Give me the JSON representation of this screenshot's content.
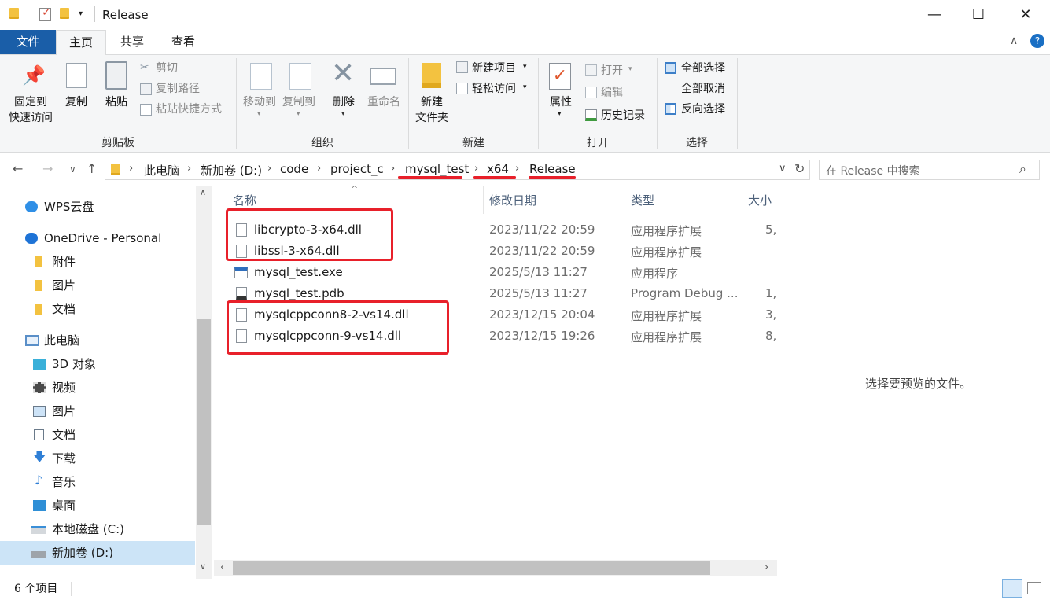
{
  "window": {
    "title": "Release",
    "controls": {
      "minimize": "—",
      "maximize": "☐",
      "close": "✕"
    }
  },
  "ribbon_tabs": {
    "file": "文件",
    "home": "主页",
    "share": "共享",
    "view": "查看"
  },
  "ribbon": {
    "clipboard": {
      "label": "剪贴板",
      "pin_line1": "固定到",
      "pin_line2": "快速访问",
      "copy": "复制",
      "paste": "粘贴",
      "cut": "剪切",
      "copy_path": "复制路径",
      "paste_shortcut": "粘贴快捷方式"
    },
    "organize": {
      "label": "组织",
      "move_to": "移动到",
      "copy_to": "复制到",
      "delete": "删除",
      "rename": "重命名"
    },
    "new": {
      "label": "新建",
      "new_folder_line1": "新建",
      "new_folder_line2": "文件夹",
      "new_item": "新建项目",
      "easy_access": "轻松访问"
    },
    "open": {
      "label": "打开",
      "properties": "属性",
      "open": "打开",
      "edit": "编辑",
      "history": "历史记录"
    },
    "select": {
      "label": "选择",
      "select_all": "全部选择",
      "select_none": "全部取消",
      "invert": "反向选择"
    }
  },
  "address": {
    "crumbs": [
      "此电脑",
      "新加卷 (D:)",
      "code",
      "project_c",
      "mysql_test",
      "x64",
      "Release"
    ],
    "search_placeholder": "在 Release 中搜索"
  },
  "nav_pane": {
    "items": [
      {
        "label": "WPS云盘",
        "icon": "cloud-icon"
      },
      {
        "label": "OneDrive - Personal",
        "icon": "onedrive-icon"
      },
      {
        "label": "附件",
        "icon": "folder-icon"
      },
      {
        "label": "图片",
        "icon": "folder-icon"
      },
      {
        "label": "文档",
        "icon": "folder-icon"
      },
      {
        "label": "此电脑",
        "icon": "computer-icon"
      },
      {
        "label": "3D 对象",
        "icon": "cube-icon"
      },
      {
        "label": "视频",
        "icon": "video-icon"
      },
      {
        "label": "图片",
        "icon": "pictures-icon"
      },
      {
        "label": "文档",
        "icon": "documents-icon"
      },
      {
        "label": "下载",
        "icon": "download-icon"
      },
      {
        "label": "音乐",
        "icon": "music-icon"
      },
      {
        "label": "桌面",
        "icon": "desktop-icon"
      },
      {
        "label": "本地磁盘 (C:)",
        "icon": "drive-icon"
      },
      {
        "label": "新加卷 (D:)",
        "icon": "drive-icon"
      }
    ]
  },
  "file_list": {
    "columns": {
      "name": "名称",
      "date": "修改日期",
      "type": "类型",
      "size": "大小"
    },
    "rows": [
      {
        "name": "libcrypto-3-x64.dll",
        "date": "2023/11/22 20:59",
        "type": "应用程序扩展",
        "size": "5,"
      },
      {
        "name": "libssl-3-x64.dll",
        "date": "2023/11/22 20:59",
        "type": "应用程序扩展",
        "size": ""
      },
      {
        "name": "mysql_test.exe",
        "date": "2025/5/13 11:27",
        "type": "应用程序",
        "size": ""
      },
      {
        "name": "mysql_test.pdb",
        "date": "2025/5/13 11:27",
        "type": "Program Debug ...",
        "size": "1,"
      },
      {
        "name": "mysqlcppconn8-2-vs14.dll",
        "date": "2023/12/15 20:04",
        "type": "应用程序扩展",
        "size": "3,"
      },
      {
        "name": "mysqlcppconn-9-vs14.dll",
        "date": "2023/12/15 19:26",
        "type": "应用程序扩展",
        "size": "8,"
      }
    ]
  },
  "preview": {
    "text": "选择要预览的文件。"
  },
  "status": {
    "count": "6 个项目"
  },
  "colors": {
    "accent": "#1a5ea8",
    "selection": "#cce4f7",
    "annotation": "#e8202a"
  }
}
